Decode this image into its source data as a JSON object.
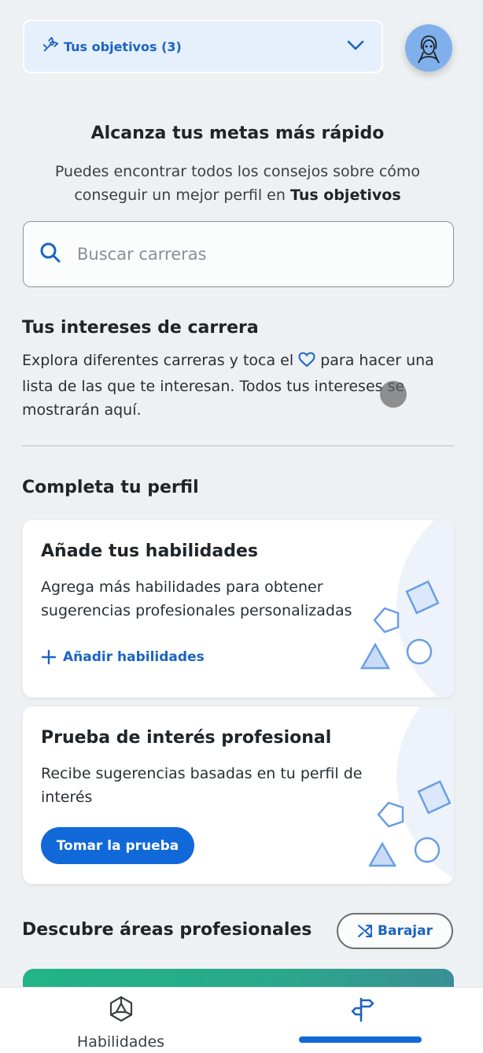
{
  "header": {
    "goals_label": "Tus objetivos (3)"
  },
  "hero": {
    "title": "Alcanza tus metas más rápido",
    "subtitle_prefix": "Puedes encontrar todos los consejos sobre cómo conseguir un mejor perfil en ",
    "subtitle_bold": "Tus objetivos"
  },
  "search": {
    "placeholder": "Buscar carreras",
    "value": ""
  },
  "interests": {
    "title": "Tus intereses de carrera",
    "text_before_icon": "Explora diferentes carreras y toca el ",
    "text_after_icon": " para hacer una lista de las que te interesan. Todos tus intereses se mostrarán aquí."
  },
  "profile": {
    "title": "Completa tu perfil",
    "cards": [
      {
        "title": "Añade tus habilidades",
        "text": "Agrega más habilidades para obtener sugerencias profesionales personalizadas",
        "action": "Añadir habilidades"
      },
      {
        "title": "Prueba de interés profesional",
        "text": "Recibe sugerencias basadas en tu perfil de interés",
        "action": "Tomar la prueba"
      }
    ]
  },
  "discover": {
    "title": "Descubre áreas profesionales",
    "shuffle_label": "Barajar"
  },
  "bottom_nav": {
    "items": [
      {
        "label": "Habilidades",
        "icon": "skills-icon"
      },
      {
        "label": "",
        "icon": "signpost-icon",
        "active": true
      }
    ]
  },
  "colors": {
    "accent": "#1168d9",
    "link": "#1a64c2",
    "background": "#eef1f3",
    "teaser_green": "#21b486"
  }
}
